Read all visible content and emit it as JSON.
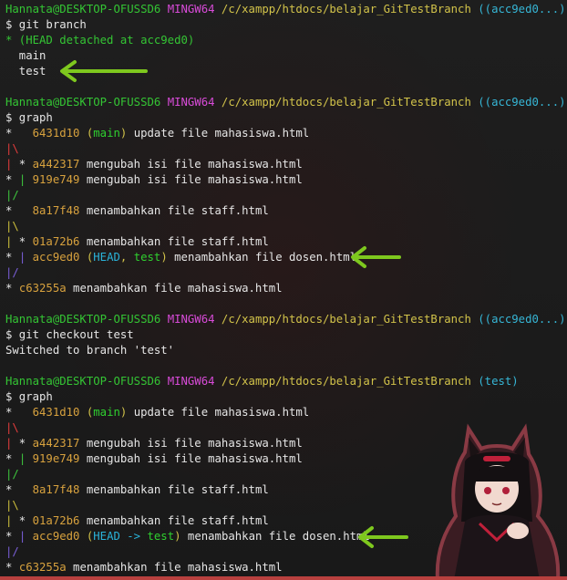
{
  "blocks": [
    {
      "type": "prompt",
      "user": "Hannata@DESKTOP-OFUSSD6",
      "sys": "MINGW64",
      "path": "/c/xampp/htdocs/belajar_GitTestBranch",
      "branch": "((acc9ed0...))"
    },
    {
      "type": "cmd",
      "text": "$ git branch"
    },
    {
      "type": "text",
      "segs": [
        {
          "t": "* (HEAD detached at acc9ed0)",
          "c": "c-green"
        }
      ]
    },
    {
      "type": "text",
      "segs": [
        {
          "t": "  main",
          "c": ""
        }
      ]
    },
    {
      "type": "text",
      "segs": [
        {
          "t": "  test",
          "c": ""
        }
      ]
    },
    {
      "type": "blank"
    },
    {
      "type": "prompt",
      "user": "Hannata@DESKTOP-OFUSSD6",
      "sys": "MINGW64",
      "path": "/c/xampp/htdocs/belajar_GitTestBranch",
      "branch": "((acc9ed0...))"
    },
    {
      "type": "cmd",
      "text": "$ graph"
    },
    {
      "type": "text",
      "segs": [
        {
          "t": "*   ",
          "c": ""
        },
        {
          "t": "6431d10",
          "c": "c-hash"
        },
        {
          "t": " (",
          "c": "c-yellow"
        },
        {
          "t": "main",
          "c": "c-gname"
        },
        {
          "t": ")",
          "c": "c-yellow"
        },
        {
          "t": " update file mahasiswa.html",
          "c": ""
        }
      ]
    },
    {
      "type": "text",
      "segs": [
        {
          "t": "|\\",
          "c": "g-red"
        }
      ]
    },
    {
      "type": "text",
      "segs": [
        {
          "t": "|",
          "c": "g-red"
        },
        {
          "t": " * ",
          "c": ""
        },
        {
          "t": "a442317",
          "c": "c-hash"
        },
        {
          "t": " mengubah isi file mahasiswa.html",
          "c": ""
        }
      ]
    },
    {
      "type": "text",
      "segs": [
        {
          "t": "* ",
          "c": ""
        },
        {
          "t": "|",
          "c": "g-green"
        },
        {
          "t": " ",
          "c": ""
        },
        {
          "t": "919e749",
          "c": "c-hash"
        },
        {
          "t": " mengubah isi file mahasiswa.html",
          "c": ""
        }
      ]
    },
    {
      "type": "text",
      "segs": [
        {
          "t": "|/",
          "c": "g-green"
        }
      ]
    },
    {
      "type": "text",
      "segs": [
        {
          "t": "*   ",
          "c": ""
        },
        {
          "t": "8a17f48",
          "c": "c-hash"
        },
        {
          "t": " menambahkan file staff.html",
          "c": ""
        }
      ]
    },
    {
      "type": "text",
      "segs": [
        {
          "t": "|\\",
          "c": "g-yellow"
        }
      ]
    },
    {
      "type": "text",
      "segs": [
        {
          "t": "|",
          "c": "g-yellow"
        },
        {
          "t": " * ",
          "c": ""
        },
        {
          "t": "01a72b6",
          "c": "c-hash"
        },
        {
          "t": " menambahkan file staff.html",
          "c": ""
        }
      ]
    },
    {
      "type": "text",
      "segs": [
        {
          "t": "* ",
          "c": ""
        },
        {
          "t": "|",
          "c": "g-purple"
        },
        {
          "t": " ",
          "c": ""
        },
        {
          "t": "acc9ed0",
          "c": "c-hash"
        },
        {
          "t": " (",
          "c": "c-yellow"
        },
        {
          "t": "HEAD",
          "c": "c-head"
        },
        {
          "t": ", ",
          "c": "c-yellow"
        },
        {
          "t": "test",
          "c": "c-test"
        },
        {
          "t": ")",
          "c": "c-yellow"
        },
        {
          "t": " menambahkan file dosen.html",
          "c": ""
        }
      ]
    },
    {
      "type": "text",
      "segs": [
        {
          "t": "|/",
          "c": "g-purple"
        }
      ]
    },
    {
      "type": "text",
      "segs": [
        {
          "t": "* ",
          "c": ""
        },
        {
          "t": "c63255a",
          "c": "c-hash"
        },
        {
          "t": " menambahkan file mahasiswa.html",
          "c": ""
        }
      ]
    },
    {
      "type": "blank"
    },
    {
      "type": "prompt",
      "user": "Hannata@DESKTOP-OFUSSD6",
      "sys": "MINGW64",
      "path": "/c/xampp/htdocs/belajar_GitTestBranch",
      "branch": "((acc9ed0...))"
    },
    {
      "type": "cmd",
      "text": "$ git checkout test"
    },
    {
      "type": "text",
      "segs": [
        {
          "t": "Switched to branch 'test'",
          "c": ""
        }
      ]
    },
    {
      "type": "blank"
    },
    {
      "type": "prompt",
      "user": "Hannata@DESKTOP-OFUSSD6",
      "sys": "MINGW64",
      "path": "/c/xampp/htdocs/belajar_GitTestBranch",
      "branch": "(test)"
    },
    {
      "type": "cmd",
      "text": "$ graph"
    },
    {
      "type": "text",
      "segs": [
        {
          "t": "*   ",
          "c": ""
        },
        {
          "t": "6431d10",
          "c": "c-hash"
        },
        {
          "t": " (",
          "c": "c-yellow"
        },
        {
          "t": "main",
          "c": "c-gname"
        },
        {
          "t": ")",
          "c": "c-yellow"
        },
        {
          "t": " update file mahasiswa.html",
          "c": ""
        }
      ]
    },
    {
      "type": "text",
      "segs": [
        {
          "t": "|\\",
          "c": "g-red"
        }
      ]
    },
    {
      "type": "text",
      "segs": [
        {
          "t": "|",
          "c": "g-red"
        },
        {
          "t": " * ",
          "c": ""
        },
        {
          "t": "a442317",
          "c": "c-hash"
        },
        {
          "t": " mengubah isi file mahasiswa.html",
          "c": ""
        }
      ]
    },
    {
      "type": "text",
      "segs": [
        {
          "t": "* ",
          "c": ""
        },
        {
          "t": "|",
          "c": "g-green"
        },
        {
          "t": " ",
          "c": ""
        },
        {
          "t": "919e749",
          "c": "c-hash"
        },
        {
          "t": " mengubah isi file mahasiswa.html",
          "c": ""
        }
      ]
    },
    {
      "type": "text",
      "segs": [
        {
          "t": "|/",
          "c": "g-green"
        }
      ]
    },
    {
      "type": "text",
      "segs": [
        {
          "t": "*   ",
          "c": ""
        },
        {
          "t": "8a17f48",
          "c": "c-hash"
        },
        {
          "t": " menambahkan file staff.html",
          "c": ""
        }
      ]
    },
    {
      "type": "text",
      "segs": [
        {
          "t": "|\\",
          "c": "g-yellow"
        }
      ]
    },
    {
      "type": "text",
      "segs": [
        {
          "t": "|",
          "c": "g-yellow"
        },
        {
          "t": " * ",
          "c": ""
        },
        {
          "t": "01a72b6",
          "c": "c-hash"
        },
        {
          "t": " menambahkan file staff.html",
          "c": ""
        }
      ]
    },
    {
      "type": "text",
      "segs": [
        {
          "t": "* ",
          "c": ""
        },
        {
          "t": "|",
          "c": "g-purple"
        },
        {
          "t": " ",
          "c": ""
        },
        {
          "t": "acc9ed0",
          "c": "c-hash"
        },
        {
          "t": " (",
          "c": "c-yellow"
        },
        {
          "t": "HEAD -> ",
          "c": "c-head"
        },
        {
          "t": "test",
          "c": "c-test"
        },
        {
          "t": ")",
          "c": "c-yellow"
        },
        {
          "t": " menambahkan file dosen.html",
          "c": ""
        }
      ]
    },
    {
      "type": "text",
      "segs": [
        {
          "t": "|/",
          "c": "g-purple"
        }
      ]
    },
    {
      "type": "text",
      "segs": [
        {
          "t": "* ",
          "c": ""
        },
        {
          "t": "c63255a",
          "c": "c-hash"
        },
        {
          "t": " menambahkan file mahasiswa.html",
          "c": ""
        }
      ]
    }
  ],
  "annotation_color": "#7ec81e",
  "colors": {
    "user": "#34c534",
    "system": "#d84bd8",
    "path": "#d2c34a",
    "branch": "#36b6d6"
  }
}
